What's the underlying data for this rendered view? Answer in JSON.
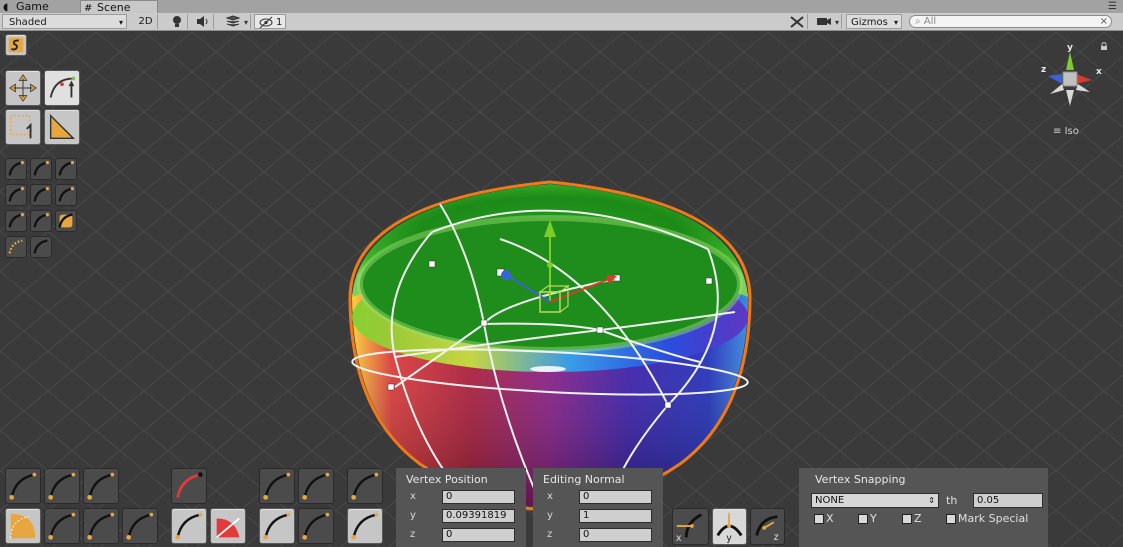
{
  "tabs": [
    {
      "label": "Game",
      "icon": "pacman-icon"
    },
    {
      "label": "Scene",
      "icon": "grid-icon"
    }
  ],
  "toolbar": {
    "shading_mode": "Shaded",
    "mode_2d": "2D",
    "hidden_count": "1",
    "gizmos_label": "Gizmos",
    "search_placeholder": "All"
  },
  "view": {
    "projection_label": "Iso",
    "gizmo_axes": [
      "x",
      "y",
      "z"
    ],
    "axis_colors": {
      "x": "#d93a2b",
      "y": "#7ccc2c",
      "z": "#3a63d9"
    }
  },
  "vertex_position": {
    "title": "Vertex Position",
    "x": "0",
    "y": "0.09391819",
    "z": "0"
  },
  "editing_normal": {
    "title": "Editing Normal",
    "x": "0",
    "y": "1",
    "z": "0"
  },
  "vertex_snapping": {
    "title": "Vertex Snapping",
    "mode": "NONE",
    "threshold_label": "th",
    "threshold": "0.05",
    "checkboxes": [
      {
        "label": "X",
        "checked": false
      },
      {
        "label": "Y",
        "checked": false
      },
      {
        "label": "Z",
        "checked": false
      },
      {
        "label": "Mark Special",
        "checked": false
      }
    ]
  },
  "normal_axis_buttons": [
    "x",
    "y",
    "z"
  ],
  "accent_colors": {
    "tool_orange": "#e8a640",
    "selection_outline": "#f07a1a"
  }
}
